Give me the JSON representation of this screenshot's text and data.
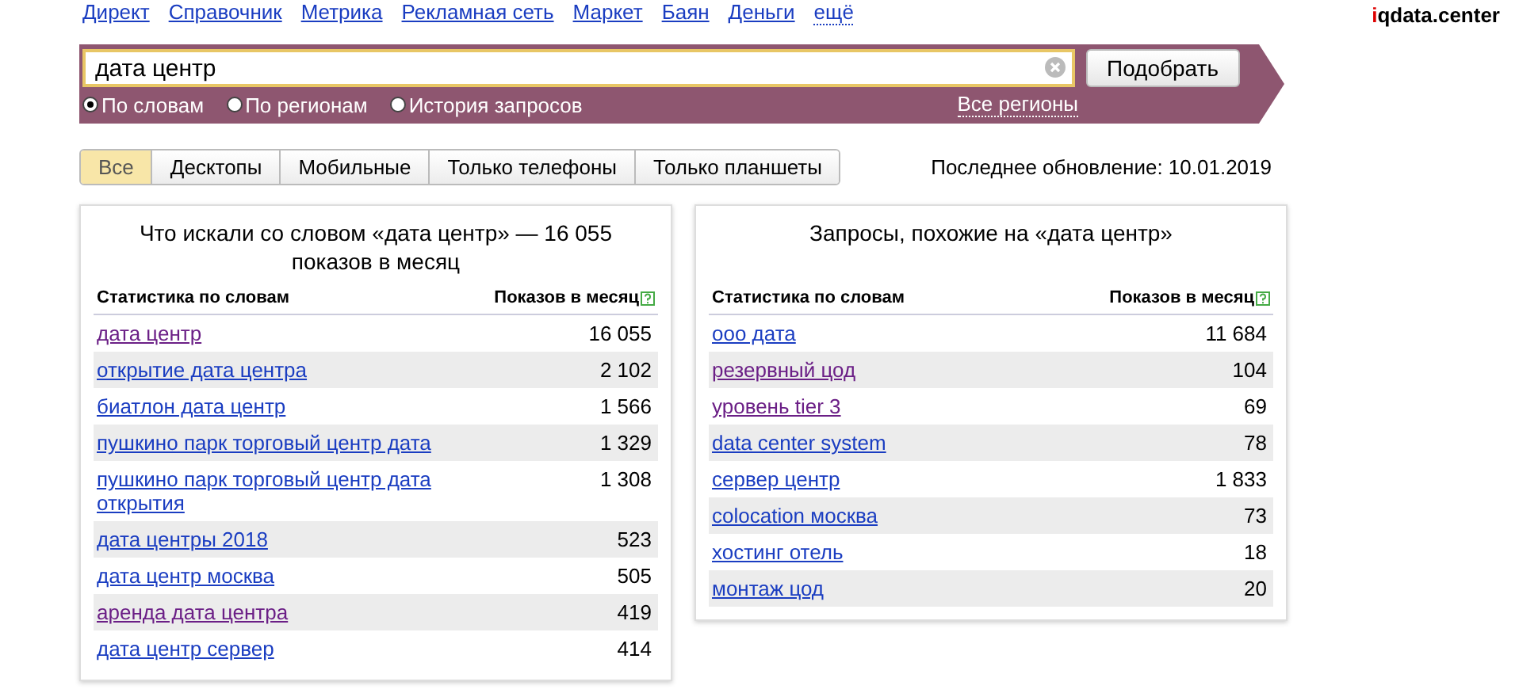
{
  "nav": [
    {
      "label": "Директ",
      "kind": "link"
    },
    {
      "label": "Справочник",
      "kind": "link"
    },
    {
      "label": "Метрика",
      "kind": "link"
    },
    {
      "label": "Рекламная сеть",
      "kind": "link"
    },
    {
      "label": "Маркет",
      "kind": "link"
    },
    {
      "label": "Баян",
      "kind": "link"
    },
    {
      "label": "Деньги",
      "kind": "link"
    },
    {
      "label": "ещё",
      "kind": "more"
    }
  ],
  "logo": {
    "accent": "i",
    "rest": "qdata.center"
  },
  "search": {
    "value": "дата центр",
    "button": "Подобрать",
    "modes": [
      {
        "label": "По словам",
        "selected": true
      },
      {
        "label": "По регионам",
        "selected": false
      },
      {
        "label": "История запросов",
        "selected": false
      }
    ],
    "regions": "Все регионы"
  },
  "tabs": [
    {
      "label": "Все",
      "selected": true
    },
    {
      "label": "Десктопы",
      "selected": false
    },
    {
      "label": "Мобильные",
      "selected": false
    },
    {
      "label": "Только телефоны",
      "selected": false
    },
    {
      "label": "Только планшеты",
      "selected": false
    }
  ],
  "last_update": "Последнее обновление: 10.01.2019",
  "panels": [
    {
      "title": "Что искали со словом «дата центр» — 16 055 показов в месяц",
      "columns": [
        "Статистика по словам",
        "Показов в месяц"
      ],
      "rows": [
        {
          "phrase": "дата центр",
          "count": "16 055",
          "visited": true
        },
        {
          "phrase": "открытие дата центра",
          "count": "2 102",
          "visited": false
        },
        {
          "phrase": "биатлон дата центр",
          "count": "1 566",
          "visited": false
        },
        {
          "phrase": "пушкино парк торговый центр дата",
          "count": "1 329",
          "visited": false
        },
        {
          "phrase": "пушкино парк торговый центр дата открытия",
          "count": "1 308",
          "visited": false
        },
        {
          "phrase": "дата центры 2018",
          "count": "523",
          "visited": false
        },
        {
          "phrase": "дата центр москва",
          "count": "505",
          "visited": false
        },
        {
          "phrase": "аренда дата центра",
          "count": "419",
          "visited": true
        },
        {
          "phrase": "дата центр сервер",
          "count": "414",
          "visited": false
        }
      ]
    },
    {
      "title": "Запросы, похожие на «дата центр»",
      "columns": [
        "Статистика по словам",
        "Показов в месяц"
      ],
      "rows": [
        {
          "phrase": "ооо дата",
          "count": "11 684",
          "visited": false
        },
        {
          "phrase": "резервный цод",
          "count": "104",
          "visited": true
        },
        {
          "phrase": "уровень tier 3",
          "count": "69",
          "visited": true
        },
        {
          "phrase": "data center system",
          "count": "78",
          "visited": false
        },
        {
          "phrase": "сервер центр",
          "count": "1 833",
          "visited": false
        },
        {
          "phrase": "colocation москва",
          "count": "73",
          "visited": false
        },
        {
          "phrase": "хостинг отель",
          "count": "18",
          "visited": false
        },
        {
          "phrase": "монтаж цод",
          "count": "20",
          "visited": false
        }
      ]
    }
  ]
}
